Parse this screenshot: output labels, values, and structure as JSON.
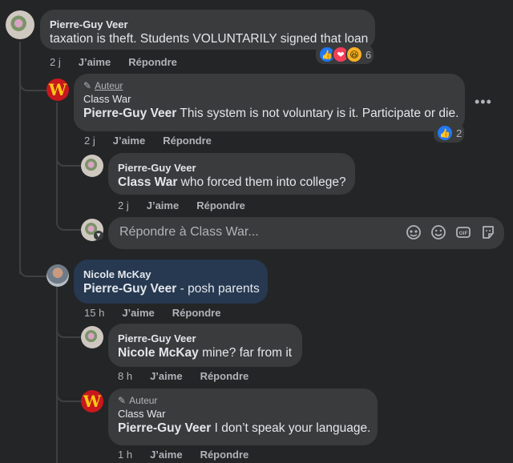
{
  "comments": [
    {
      "author": "Pierre-Guy Veer",
      "text": "taxation is theft. Students VOLUNTARILY signed that loan",
      "time": "2 j",
      "like_label": "J’aime",
      "reply_label": "Répondre",
      "reaction_count": "6"
    },
    {
      "badge": "Auteur",
      "author": "Class War",
      "mention": "Pierre-Guy Veer",
      "text": " This system is not voluntary is it. Participate or die.",
      "time": "2 j",
      "like_label": "J’aime",
      "reply_label": "Répondre",
      "reaction_count": "2"
    },
    {
      "author": "Pierre-Guy Veer",
      "mention": "Class War",
      "text": " who forced them into college?",
      "time": "2 j",
      "like_label": "J’aime",
      "reply_label": "Répondre"
    },
    {
      "author": "Nicole McKay",
      "mention": "Pierre-Guy Veer",
      "text": " - posh parents",
      "time": "15 h",
      "like_label": "J’aime",
      "reply_label": "Répondre"
    },
    {
      "author": "Pierre-Guy Veer",
      "mention": "Nicole McKay",
      "text": " mine? far from it",
      "time": "8 h",
      "like_label": "J’aime",
      "reply_label": "Répondre"
    },
    {
      "badge": "Auteur",
      "author": "Class War",
      "mention": "Pierre-Guy Veer",
      "text": " I don’t speak your language.",
      "time": "1 h",
      "like_label": "J’aime",
      "reply_label": "Répondre"
    }
  ],
  "reply_box": {
    "placeholder": "Répondre à Class War..."
  },
  "more_options": "•••"
}
